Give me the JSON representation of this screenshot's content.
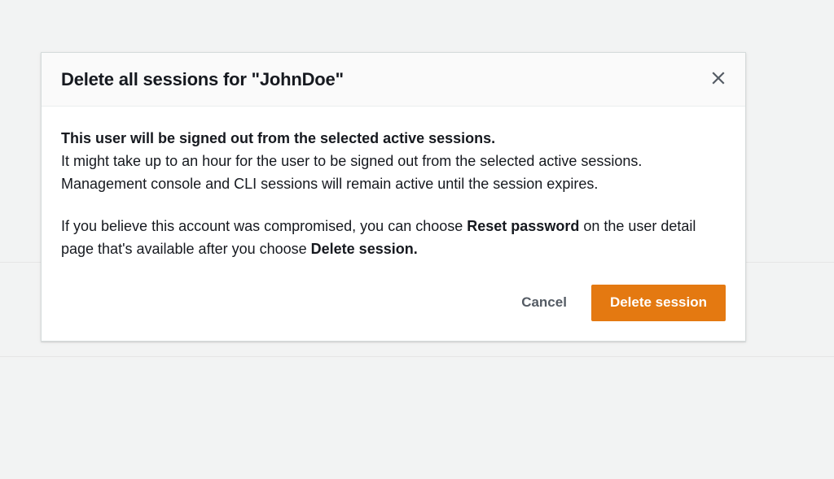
{
  "modal": {
    "title": "Delete all sessions for \"JohnDoe\"",
    "body": {
      "heading": "This user will be signed out from the selected active sessions.",
      "para1": "It might take up to an hour for the user to be signed out from the selected active sessions. Management console and CLI sessions will remain active until the session expires.",
      "para2_prefix": "If you believe this account was compromised, you can choose ",
      "para2_strong1": "Reset password",
      "para2_mid": " on the user detail page that's available after you choose ",
      "para2_strong2": "Delete session."
    },
    "footer": {
      "cancel": "Cancel",
      "confirm": "Delete session"
    }
  }
}
